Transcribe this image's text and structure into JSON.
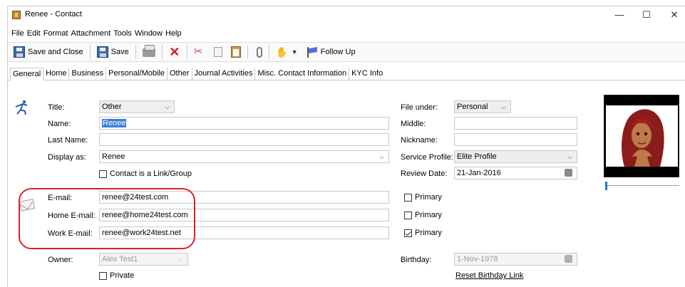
{
  "window": {
    "title": "Renee  - Contact",
    "minimize_glyph": "—",
    "maximize_glyph": "☐",
    "close_glyph": "✕"
  },
  "menu": [
    "File",
    "Edit",
    "Format",
    "Attachment",
    "Tools",
    "Window",
    "Help"
  ],
  "toolbar": {
    "save_close_label": "Save and Close",
    "save_label": "Save",
    "follow_up_label": "Follow Up"
  },
  "tabs": [
    "General",
    "Home",
    "Business",
    "Personal/Mobile",
    "Other",
    "Journal Activities",
    "Misc. Contact Information",
    "KYC Info"
  ],
  "form": {
    "title_label": "Title:",
    "title_value": "Other",
    "name_label": "Name:",
    "name_value": "Renee",
    "last_name_label": "Last Name:",
    "last_name_value": "",
    "display_as_label": "Display as:",
    "display_as_value": "Renee",
    "contact_group_label": "Contact is a Link/Group",
    "file_under_label": "File under:",
    "file_under_value": "Personal",
    "middle_label": "Middle:",
    "middle_value": "",
    "nickname_label": "Nickname:",
    "nickname_value": "",
    "service_profile_label": "Service Profile:",
    "service_profile_value": "Elite Profile",
    "review_date_label": "Review Date:",
    "review_date_value": "21-Jan-2016",
    "email_label": "E-mail:",
    "email_value": "renee@24test.com",
    "home_email_label": "Home E-mail:",
    "home_email_value": "renee@home24test.com",
    "work_email_label": "Work E-mail:",
    "work_email_value": "renee@work24test.net",
    "primary_label": "Primary",
    "owner_label": "Owner:",
    "owner_value": "Alex Test1",
    "private_label": "Private",
    "birthday_label": "Birthday:",
    "birthday_value": "1-Nov-1978",
    "reset_birthday_label": "Reset Birthday Link"
  },
  "colors": {
    "highlight_oval": "#e02020",
    "selection": "#3b7fd9"
  }
}
